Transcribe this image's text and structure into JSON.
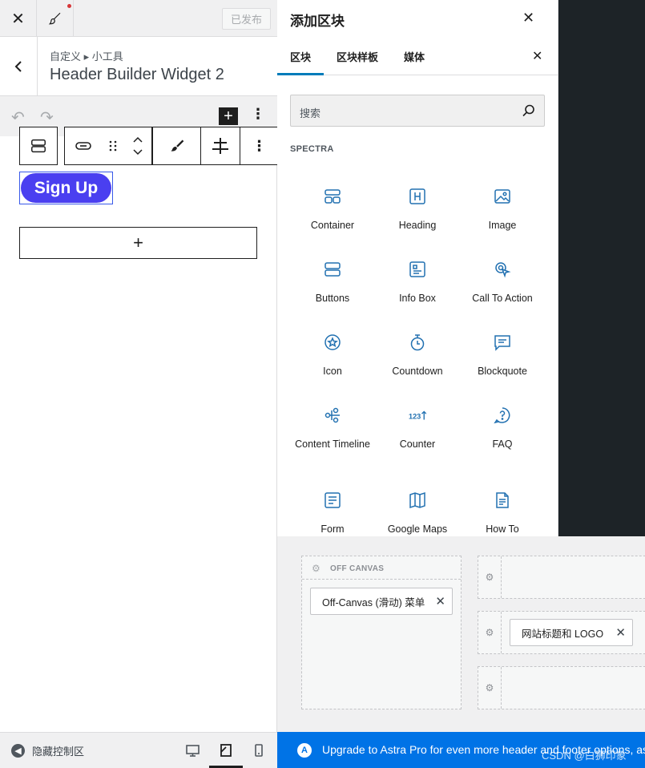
{
  "topbar": {
    "publish_label": "已发布"
  },
  "titlebar": {
    "breadcrumb": "自定义 ▸ 小工具",
    "title": "Header Builder Widget 2"
  },
  "canvas": {
    "signup_label": "Sign Up",
    "appender_label": "+"
  },
  "footer": {
    "hide_controls": "隐藏控制区"
  },
  "inserter": {
    "title": "添加区块",
    "tabs": [
      "区块",
      "区块样板",
      "媒体"
    ],
    "active_tab": "区块",
    "search_placeholder": "搜索",
    "category": "SPECTRA",
    "blocks": [
      {
        "label": "Container",
        "icon": "container-icon"
      },
      {
        "label": "Heading",
        "icon": "heading-icon"
      },
      {
        "label": "Image",
        "icon": "image-icon"
      },
      {
        "label": "Buttons",
        "icon": "buttons-icon"
      },
      {
        "label": "Info Box",
        "icon": "info-box-icon"
      },
      {
        "label": "Call To Action",
        "icon": "call-to-action-icon"
      },
      {
        "label": "Icon",
        "icon": "star-circle-icon"
      },
      {
        "label": "Countdown",
        "icon": "stopwatch-icon"
      },
      {
        "label": "Blockquote",
        "icon": "quote-icon"
      },
      {
        "label": "Content Timeline",
        "icon": "timeline-icon"
      },
      {
        "label": "Counter",
        "icon": "counter-icon"
      },
      {
        "label": "FAQ",
        "icon": "faq-icon"
      },
      {
        "label": "Form",
        "icon": "form-icon"
      },
      {
        "label": "Google Maps",
        "icon": "map-icon"
      },
      {
        "label": "How To",
        "icon": "how-to-icon"
      }
    ]
  },
  "builder": {
    "off_canvas_title": "OFF CANVAS",
    "off_canvas_item": "Off-Canvas (滑动) 菜单",
    "site_title_item": "网站标题和 LOGO"
  },
  "upgrade": {
    "text": "Upgrade to Astra Pro for even more header and footer options, as w",
    "watermark": "CSDN @白狮印象",
    "logo_letter": "A"
  },
  "colors": {
    "accent": "#007cba",
    "signup_button": "#4a3ff0",
    "upgrade_bar": "#0073e6",
    "dark_panel": "#1d2327"
  }
}
